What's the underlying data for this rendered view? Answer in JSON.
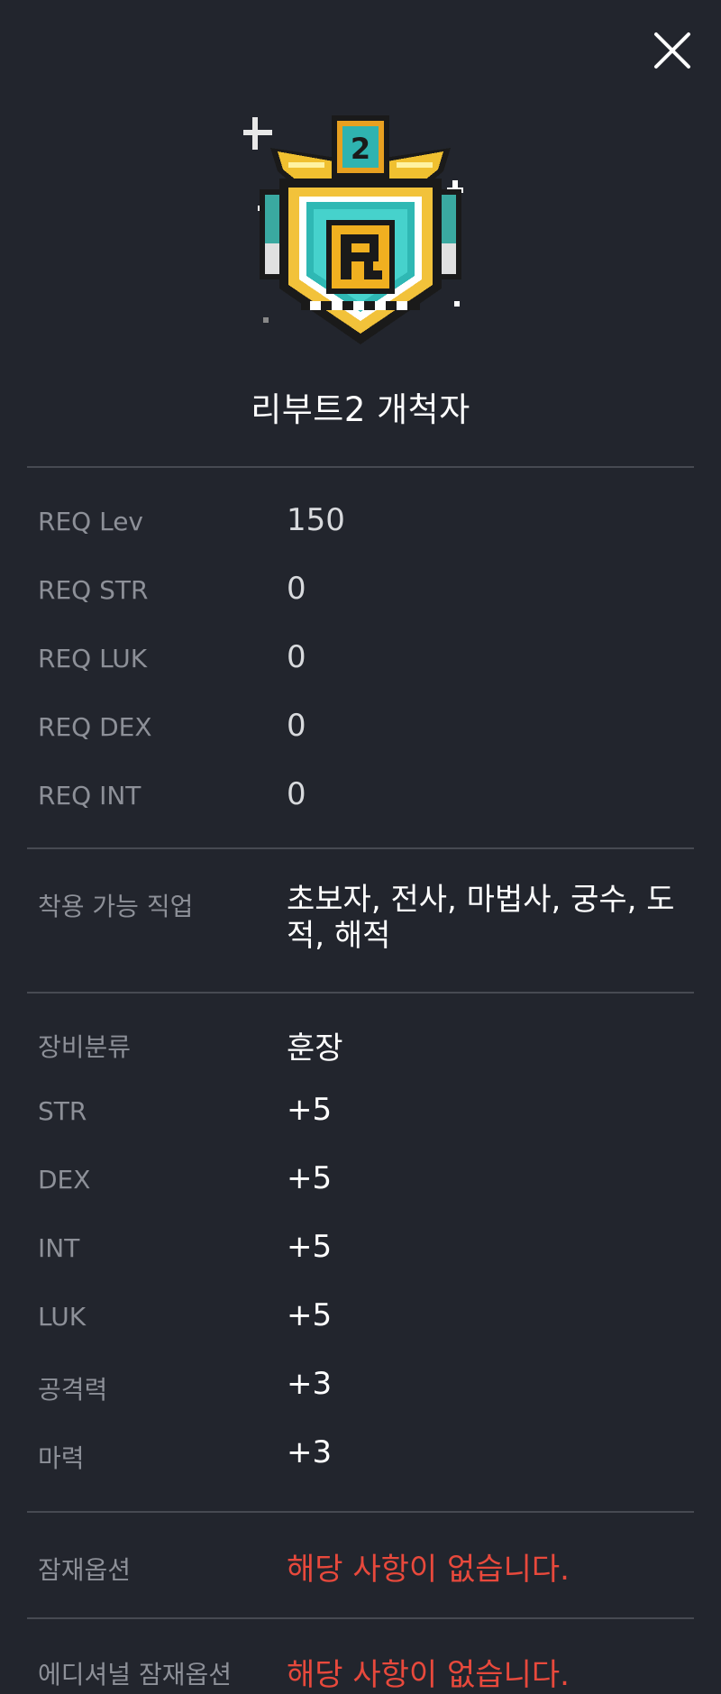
{
  "item": {
    "name": "리부트2 개척자",
    "icon": "reboot2-pioneer-medal-icon"
  },
  "close_icon": "close-icon",
  "requirements": [
    {
      "label": "REQ Lev",
      "value": "150"
    },
    {
      "label": "REQ STR",
      "value": "0"
    },
    {
      "label": "REQ LUK",
      "value": "0"
    },
    {
      "label": "REQ DEX",
      "value": "0"
    },
    {
      "label": "REQ INT",
      "value": "0"
    }
  ],
  "jobs": {
    "label": "착용 가능 직업",
    "value": "초보자, 전사, 마법사, 궁수, 도적, 해적"
  },
  "stats": [
    {
      "label": "장비분류",
      "value": "훈장"
    },
    {
      "label": "STR",
      "value": "+5"
    },
    {
      "label": "DEX",
      "value": "+5"
    },
    {
      "label": "INT",
      "value": "+5"
    },
    {
      "label": "LUK",
      "value": "+5"
    },
    {
      "label": "공격력",
      "value": "+3"
    },
    {
      "label": "마력",
      "value": "+3"
    }
  ],
  "potential": {
    "label": "잠재옵션",
    "value": "해당 사항이 없습니다."
  },
  "additional_potential": {
    "label": "에디셔널 잠재옵션",
    "value": "해당 사항이 없습니다."
  },
  "colors": {
    "background": "#22252d",
    "divider": "#474a52",
    "label": "#8d9098",
    "value": "#d8dadd",
    "none_text": "#e8493c"
  }
}
